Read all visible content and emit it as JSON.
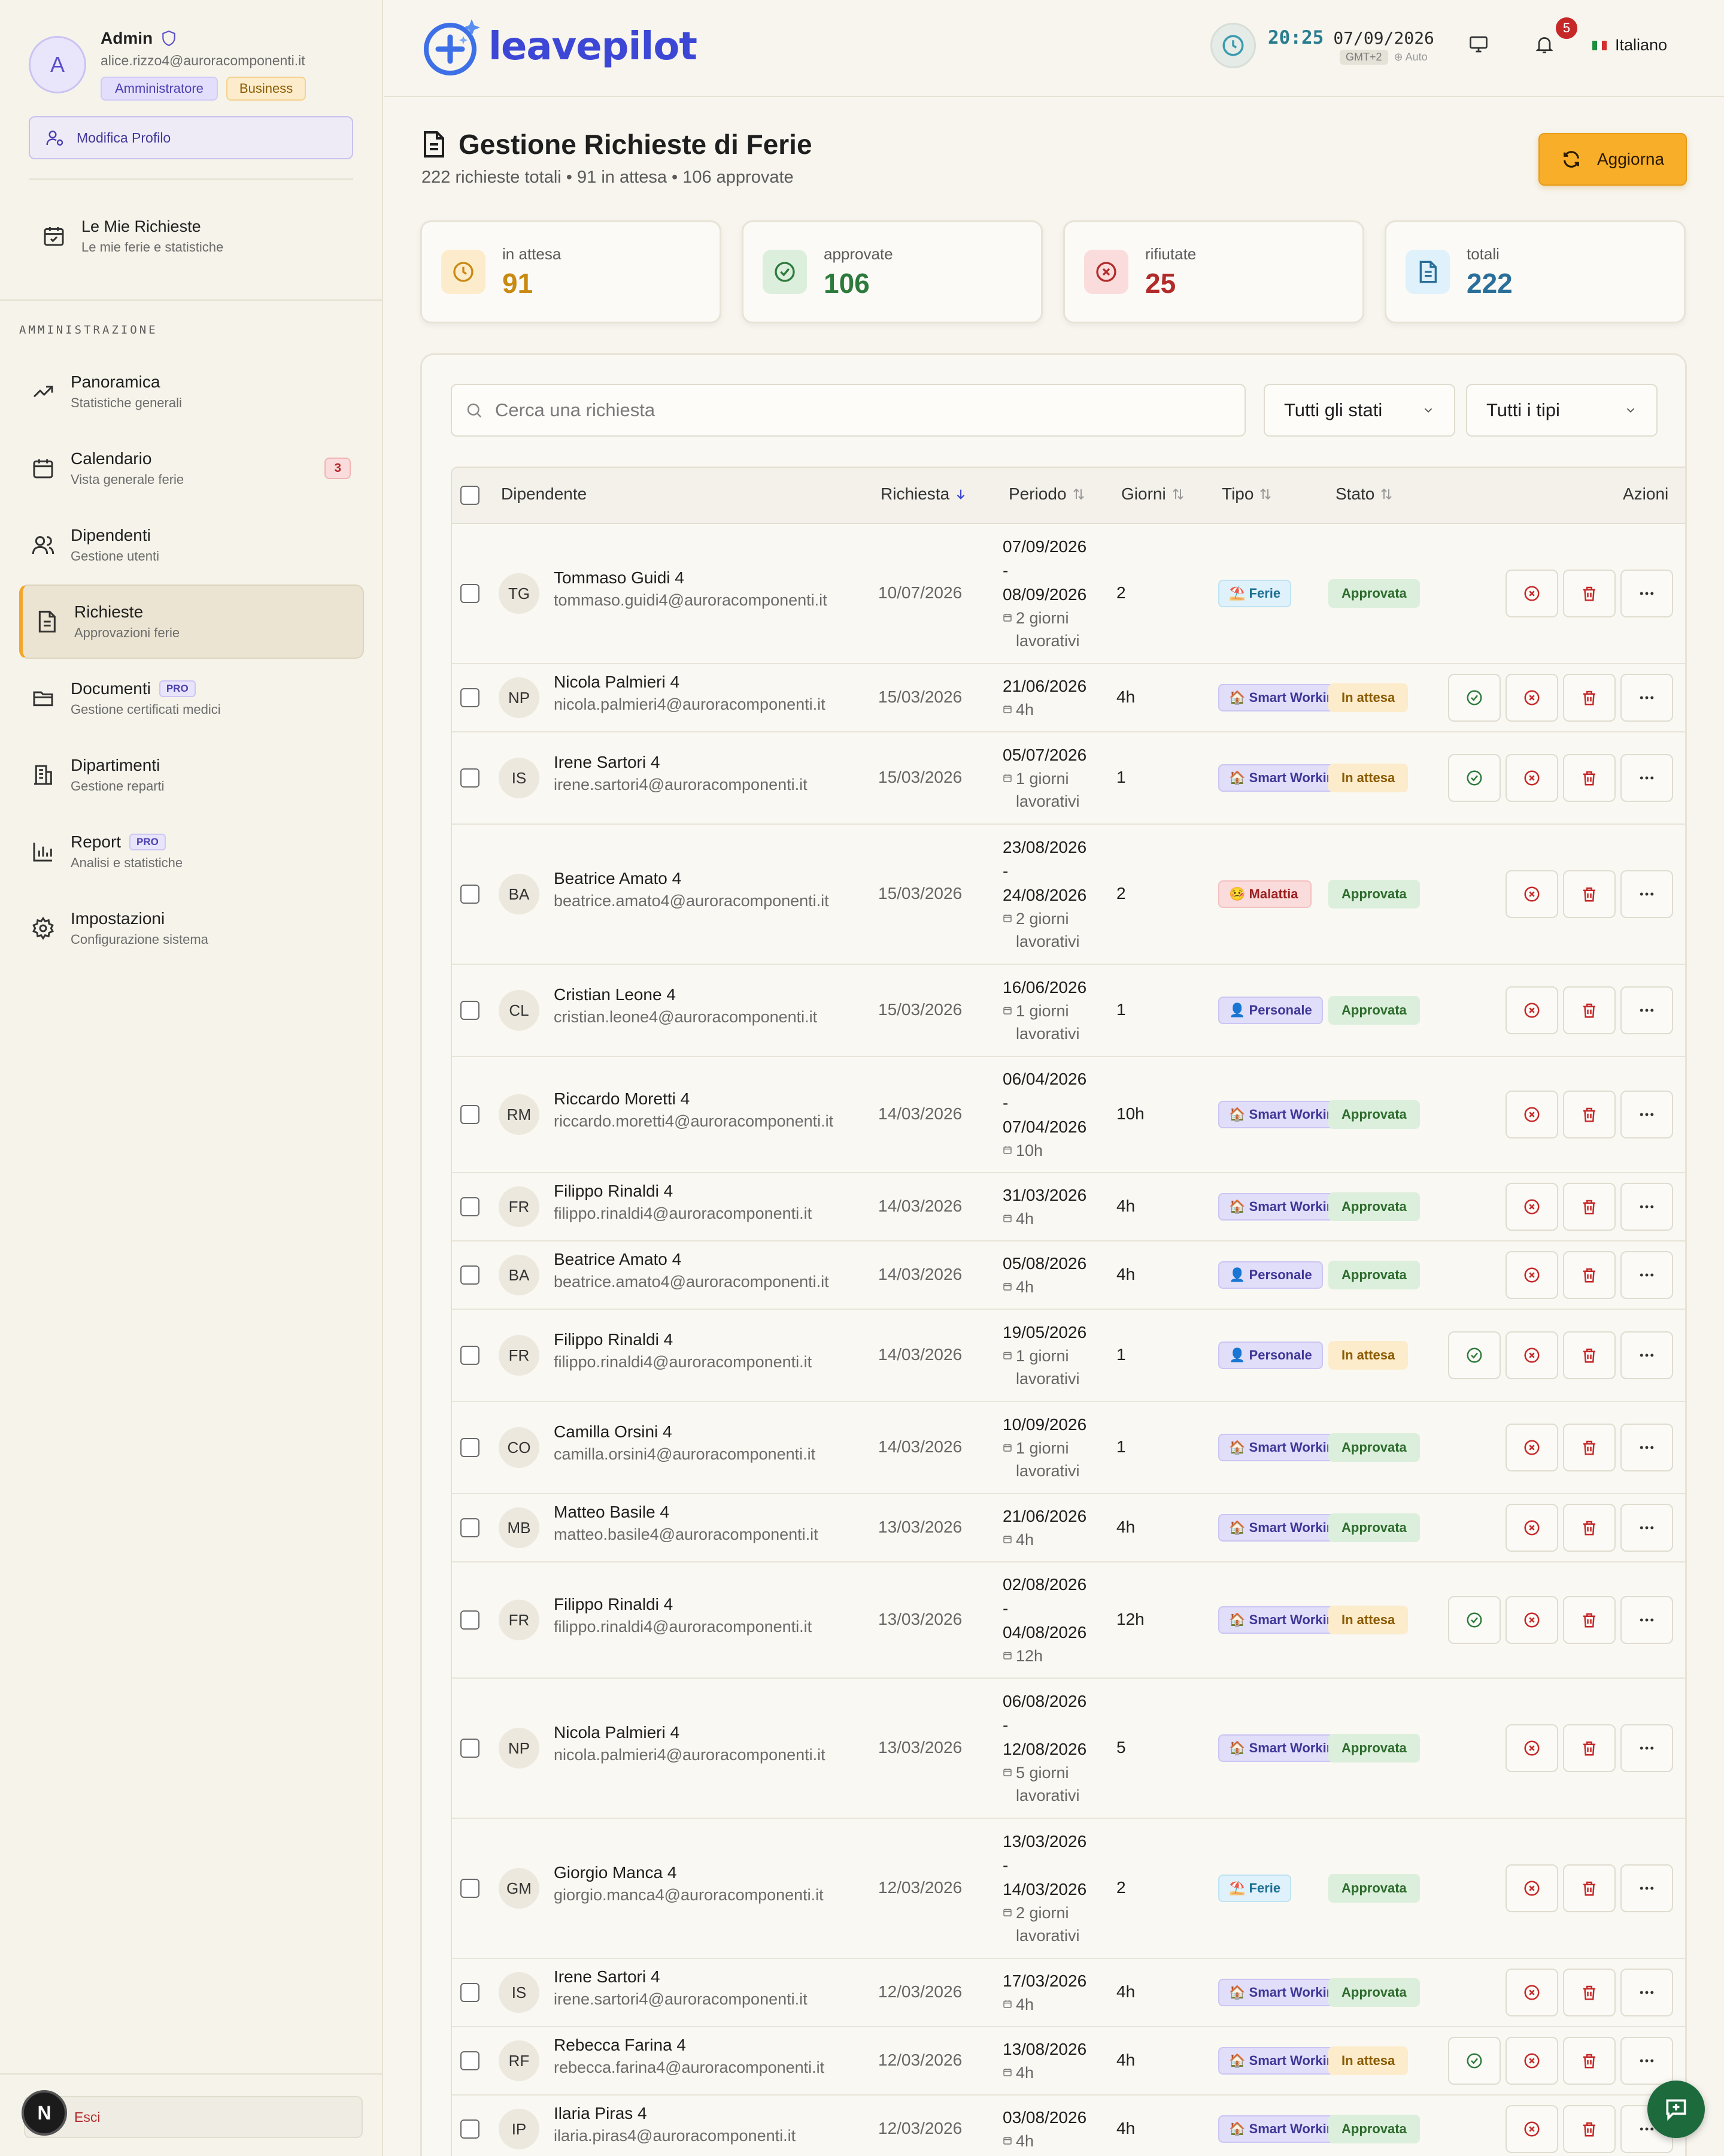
{
  "profile": {
    "initial": "A",
    "name": "Admin",
    "email": "alice.rizzo4@auroracomponenti.it",
    "role": "Amministratore",
    "plan": "Business",
    "edit_label": "Modifica Profilo"
  },
  "my_requests": {
    "title": "Le Mie Richieste",
    "subtitle": "Le mie ferie e statistiche"
  },
  "admin_section_label": "AMMINISTRAZIONE",
  "nav": [
    {
      "title": "Panoramica",
      "subtitle": "Statistiche generali",
      "icon": "trend-icon"
    },
    {
      "title": "Calendario",
      "subtitle": "Vista generale ferie",
      "icon": "calendar-icon",
      "count": "3"
    },
    {
      "title": "Dipendenti",
      "subtitle": "Gestione utenti",
      "icon": "users-icon"
    },
    {
      "title": "Richieste",
      "subtitle": "Approvazioni ferie",
      "icon": "document-icon",
      "active": true
    },
    {
      "title": "Documenti",
      "subtitle": "Gestione certificati medici",
      "icon": "folder-icon",
      "pro": "PRO"
    },
    {
      "title": "Dipartimenti",
      "subtitle": "Gestione reparti",
      "icon": "building-icon"
    },
    {
      "title": "Report",
      "subtitle": "Analisi e statistiche",
      "icon": "bar-chart-icon",
      "pro": "PRO"
    },
    {
      "title": "Impostazioni",
      "subtitle": "Configurazione sistema",
      "icon": "gear-icon"
    }
  ],
  "logout": {
    "initial": "N",
    "label": "Esci"
  },
  "topbar": {
    "logo_text": "leavepilot",
    "time": "20:25",
    "date": "07/09/2026",
    "timezone": "GMT+2",
    "tz_mode": "Auto",
    "notifications": "5",
    "language": "Italiano"
  },
  "page": {
    "title": "Gestione Richieste di Ferie",
    "subtitle": "222 richieste totali • 91 in attesa • 106 approvate",
    "refresh_label": "Aggiorna"
  },
  "stats": [
    {
      "label": "in attesa",
      "value": "91",
      "color": "#c98a12",
      "bg": "#fdeccb"
    },
    {
      "label": "approvate",
      "value": "106",
      "color": "#2d7a3d",
      "bg": "#dcefdc"
    },
    {
      "label": "rifiutate",
      "value": "25",
      "color": "#b12b2b",
      "bg": "#fbdcdc"
    },
    {
      "label": "totali",
      "value": "222",
      "color": "#2a6f9a",
      "bg": "#dff1fb"
    }
  ],
  "filters": {
    "search_placeholder": "Cerca una richiesta",
    "status": "Tutti gli stati",
    "type": "Tutti i tipi"
  },
  "columns": {
    "employee": "Dipendente",
    "request": "Richiesta",
    "period": "Periodo",
    "days": "Giorni",
    "type": "Tipo",
    "status": "Stato",
    "actions": "Azioni"
  },
  "rows": [
    {
      "initials": "TG",
      "name": "Tommaso Guidi 4",
      "email": "tommaso.guidi4@auroracomponenti.it",
      "request": "10/07/2026",
      "start": "07/09/2026",
      "end": "08/09/2026",
      "duration": "2 giorni lavorativi",
      "days": "2",
      "type": "ferie",
      "type_label": "Ferie",
      "type_emoji": "⛱️",
      "status": "ok",
      "status_label": "Approvata"
    },
    {
      "initials": "NP",
      "name": "Nicola Palmieri 4",
      "email": "nicola.palmieri4@auroracomponenti.it",
      "request": "15/03/2026",
      "start": "21/06/2026",
      "end": "",
      "duration": "4h",
      "days": "4h",
      "type": "smart",
      "type_label": "Smart Working",
      "type_emoji": "🏠",
      "status": "wait",
      "status_label": "In attesa"
    },
    {
      "initials": "IS",
      "name": "Irene Sartori 4",
      "email": "irene.sartori4@auroracomponenti.it",
      "request": "15/03/2026",
      "start": "05/07/2026",
      "end": "",
      "duration": "1 giorni lavorativi",
      "days": "1",
      "type": "smart",
      "type_label": "Smart Working",
      "type_emoji": "🏠",
      "status": "wait",
      "status_label": "In attesa"
    },
    {
      "initials": "BA",
      "name": "Beatrice Amato 4",
      "email": "beatrice.amato4@auroracomponenti.it",
      "request": "15/03/2026",
      "start": "23/08/2026",
      "end": "24/08/2026",
      "duration": "2 giorni lavorativi",
      "days": "2",
      "type": "mal",
      "type_label": "Malattia",
      "type_emoji": "🤒",
      "status": "ok",
      "status_label": "Approvata"
    },
    {
      "initials": "CL",
      "name": "Cristian Leone 4",
      "email": "cristian.leone4@auroracomponenti.it",
      "request": "15/03/2026",
      "start": "16/06/2026",
      "end": "",
      "duration": "1 giorni lavorativi",
      "days": "1",
      "type": "pers",
      "type_label": "Personale",
      "type_emoji": "👤",
      "status": "ok",
      "status_label": "Approvata"
    },
    {
      "initials": "RM",
      "name": "Riccardo Moretti 4",
      "email": "riccardo.moretti4@auroracomponenti.it",
      "request": "14/03/2026",
      "start": "06/04/2026",
      "end": "07/04/2026",
      "duration": "10h",
      "days": "10h",
      "type": "smart",
      "type_label": "Smart Working",
      "type_emoji": "🏠",
      "status": "ok",
      "status_label": "Approvata"
    },
    {
      "initials": "FR",
      "name": "Filippo Rinaldi 4",
      "email": "filippo.rinaldi4@auroracomponenti.it",
      "request": "14/03/2026",
      "start": "31/03/2026",
      "end": "",
      "duration": "4h",
      "days": "4h",
      "type": "smart",
      "type_label": "Smart Working",
      "type_emoji": "🏠",
      "status": "ok",
      "status_label": "Approvata"
    },
    {
      "initials": "BA",
      "name": "Beatrice Amato 4",
      "email": "beatrice.amato4@auroracomponenti.it",
      "request": "14/03/2026",
      "start": "05/08/2026",
      "end": "",
      "duration": "4h",
      "days": "4h",
      "type": "pers",
      "type_label": "Personale",
      "type_emoji": "👤",
      "status": "ok",
      "status_label": "Approvata"
    },
    {
      "initials": "FR",
      "name": "Filippo Rinaldi 4",
      "email": "filippo.rinaldi4@auroracomponenti.it",
      "request": "14/03/2026",
      "start": "19/05/2026",
      "end": "",
      "duration": "1 giorni lavorativi",
      "days": "1",
      "type": "pers",
      "type_label": "Personale",
      "type_emoji": "👤",
      "status": "wait",
      "status_label": "In attesa"
    },
    {
      "initials": "CO",
      "name": "Camilla Orsini 4",
      "email": "camilla.orsini4@auroracomponenti.it",
      "request": "14/03/2026",
      "start": "10/09/2026",
      "end": "",
      "duration": "1 giorni lavorativi",
      "days": "1",
      "type": "smart",
      "type_label": "Smart Working",
      "type_emoji": "🏠",
      "status": "ok",
      "status_label": "Approvata"
    },
    {
      "initials": "MB",
      "name": "Matteo Basile 4",
      "email": "matteo.basile4@auroracomponenti.it",
      "request": "13/03/2026",
      "start": "21/06/2026",
      "end": "",
      "duration": "4h",
      "days": "4h",
      "type": "smart",
      "type_label": "Smart Working",
      "type_emoji": "🏠",
      "status": "ok",
      "status_label": "Approvata"
    },
    {
      "initials": "FR",
      "name": "Filippo Rinaldi 4",
      "email": "filippo.rinaldi4@auroracomponenti.it",
      "request": "13/03/2026",
      "start": "02/08/2026",
      "end": "04/08/2026",
      "duration": "12h",
      "days": "12h",
      "type": "smart",
      "type_label": "Smart Working",
      "type_emoji": "🏠",
      "status": "wait",
      "status_label": "In attesa"
    },
    {
      "initials": "NP",
      "name": "Nicola Palmieri 4",
      "email": "nicola.palmieri4@auroracomponenti.it",
      "request": "13/03/2026",
      "start": "06/08/2026",
      "end": "12/08/2026",
      "duration": "5 giorni lavorativi",
      "days": "5",
      "type": "smart",
      "type_label": "Smart Working",
      "type_emoji": "🏠",
      "status": "ok",
      "status_label": "Approvata"
    },
    {
      "initials": "GM",
      "name": "Giorgio Manca 4",
      "email": "giorgio.manca4@auroracomponenti.it",
      "request": "12/03/2026",
      "start": "13/03/2026",
      "end": "14/03/2026",
      "duration": "2 giorni lavorativi",
      "days": "2",
      "type": "ferie",
      "type_label": "Ferie",
      "type_emoji": "⛱️",
      "status": "ok",
      "status_label": "Approvata"
    },
    {
      "initials": "IS",
      "name": "Irene Sartori 4",
      "email": "irene.sartori4@auroracomponenti.it",
      "request": "12/03/2026",
      "start": "17/03/2026",
      "end": "",
      "duration": "4h",
      "days": "4h",
      "type": "smart",
      "type_label": "Smart Working",
      "type_emoji": "🏠",
      "status": "ok",
      "status_label": "Approvata"
    },
    {
      "initials": "RF",
      "name": "Rebecca Farina 4",
      "email": "rebecca.farina4@auroracomponenti.it",
      "request": "12/03/2026",
      "start": "13/08/2026",
      "end": "",
      "duration": "4h",
      "days": "4h",
      "type": "smart",
      "type_label": "Smart Working",
      "type_emoji": "🏠",
      "status": "wait",
      "status_label": "In attesa"
    },
    {
      "initials": "IP",
      "name": "Ilaria Piras 4",
      "email": "ilaria.piras4@auroracomponenti.it",
      "request": "12/03/2026",
      "start": "03/08/2026",
      "end": "",
      "duration": "4h",
      "days": "4h",
      "type": "smart",
      "type_label": "Smart Working",
      "type_emoji": "🏠",
      "status": "ok",
      "status_label": "Approvata"
    }
  ]
}
